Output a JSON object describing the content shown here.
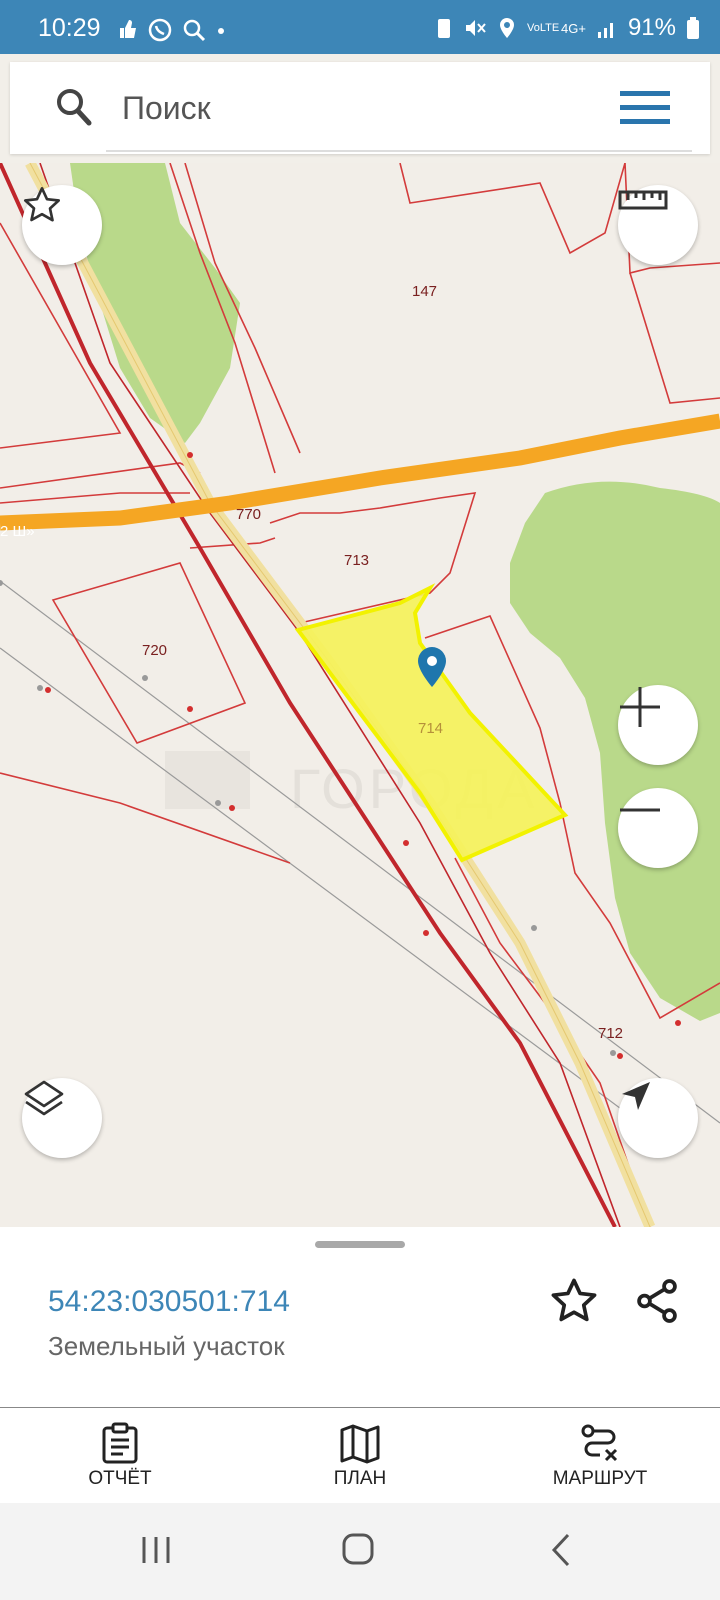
{
  "status": {
    "time": "10:29",
    "battery": "91%",
    "network": "4G+",
    "volte": "VoLTE"
  },
  "search": {
    "placeholder": "Поиск"
  },
  "map": {
    "labels": {
      "p147": "147",
      "p770": "770",
      "p713": "713",
      "p720": "720",
      "p714": "714",
      "p712": "712",
      "road": "2 Ш»"
    },
    "watermark": "ГОРОДА",
    "colors": {
      "selected_fill": "#f5f25a",
      "selected_stroke": "#f2f200",
      "boundary": "#d32e2e",
      "road": "#f5a623",
      "green": "#b9d98a",
      "marker": "#1f76ad"
    }
  },
  "parcel": {
    "cadastral_number": "54:23:030501:714",
    "type": "Земельный участок"
  },
  "nav": {
    "report": "ОТЧЁТ",
    "plan": "ПЛАН",
    "route": "МАРШРУТ"
  }
}
